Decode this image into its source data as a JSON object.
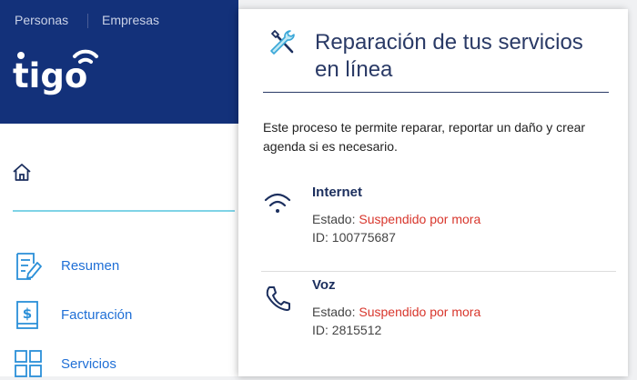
{
  "topnav": {
    "personas": "Personas",
    "empresas": "Empresas"
  },
  "brand": {
    "logo_text": "tigo",
    "color": "#13317a"
  },
  "sidebar": {
    "home_label": "",
    "items": [
      {
        "label": "Resumen",
        "icon": "document-edit-icon"
      },
      {
        "label": "Facturación",
        "icon": "invoice-dollar-icon"
      },
      {
        "label": "Servicios",
        "icon": "grid-icon"
      }
    ]
  },
  "panel": {
    "title": "Reparación de tus servicios en línea",
    "intro": "Este proceso te permite reparar, reportar un daño y crear agenda si es necesario.",
    "services": [
      {
        "name": "Internet",
        "icon": "wifi-icon",
        "estado_label": "Estado:",
        "estado": "Suspendido por mora",
        "id_label": "ID:",
        "id": "100775687"
      },
      {
        "name": "Voz",
        "icon": "phone-icon",
        "estado_label": "Estado:",
        "estado": "Suspendido por mora",
        "id_label": "ID:",
        "id": "2815512"
      }
    ]
  },
  "colors": {
    "accent": "#1f6fd6",
    "status_red": "#d8362c",
    "divider": "#7fd3e6"
  }
}
